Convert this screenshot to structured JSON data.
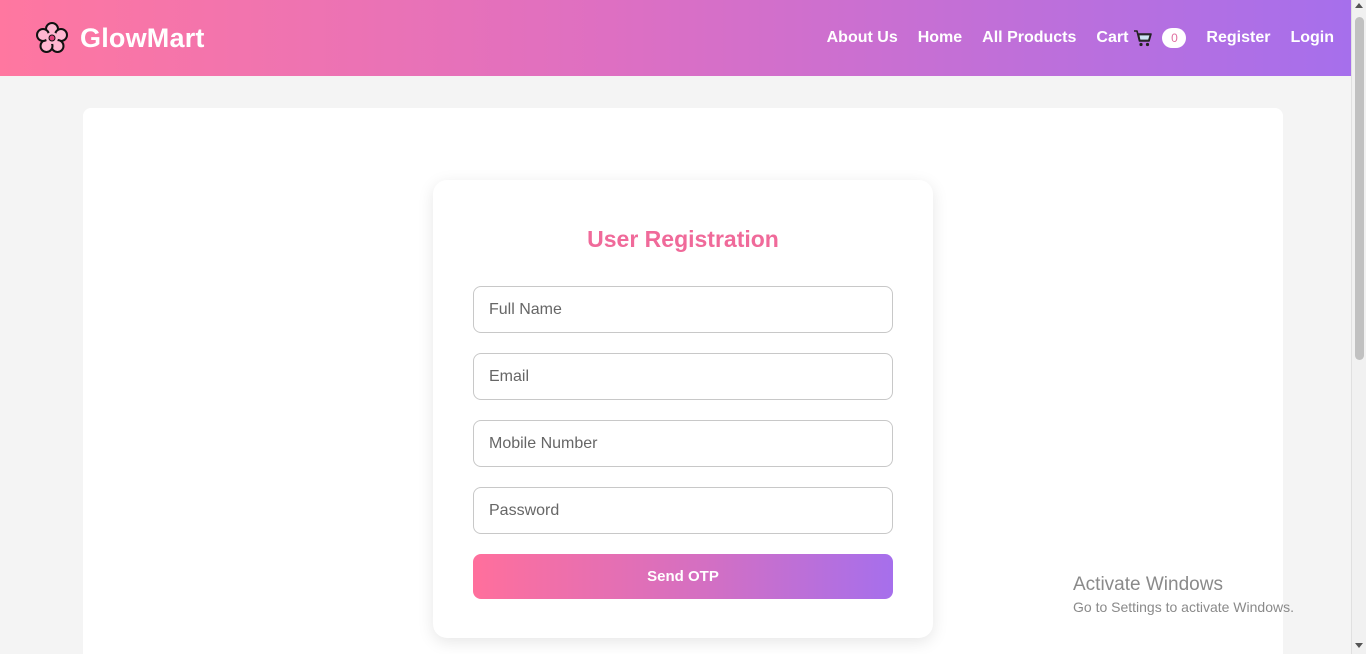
{
  "navbar": {
    "brand_name": "GlowMart",
    "brand_icon": "flower-icon",
    "links": {
      "about": "About Us",
      "home": "Home",
      "products": "All Products",
      "cart": "Cart",
      "cart_count": "0",
      "register": "Register",
      "login": "Login"
    },
    "cart_icon": "shopping-cart-icon"
  },
  "registration": {
    "title": "User Registration",
    "fields": {
      "full_name_placeholder": "Full Name",
      "email_placeholder": "Email",
      "mobile_placeholder": "Mobile Number",
      "password_placeholder": "Password"
    },
    "submit_label": "Send OTP"
  },
  "watermark": {
    "title": "Activate Windows",
    "subtitle": "Go to Settings to activate Windows."
  },
  "colors": {
    "gradient_start": "#ff77a0",
    "gradient_end": "#a66fec",
    "title_pink": "#f06a9a"
  }
}
